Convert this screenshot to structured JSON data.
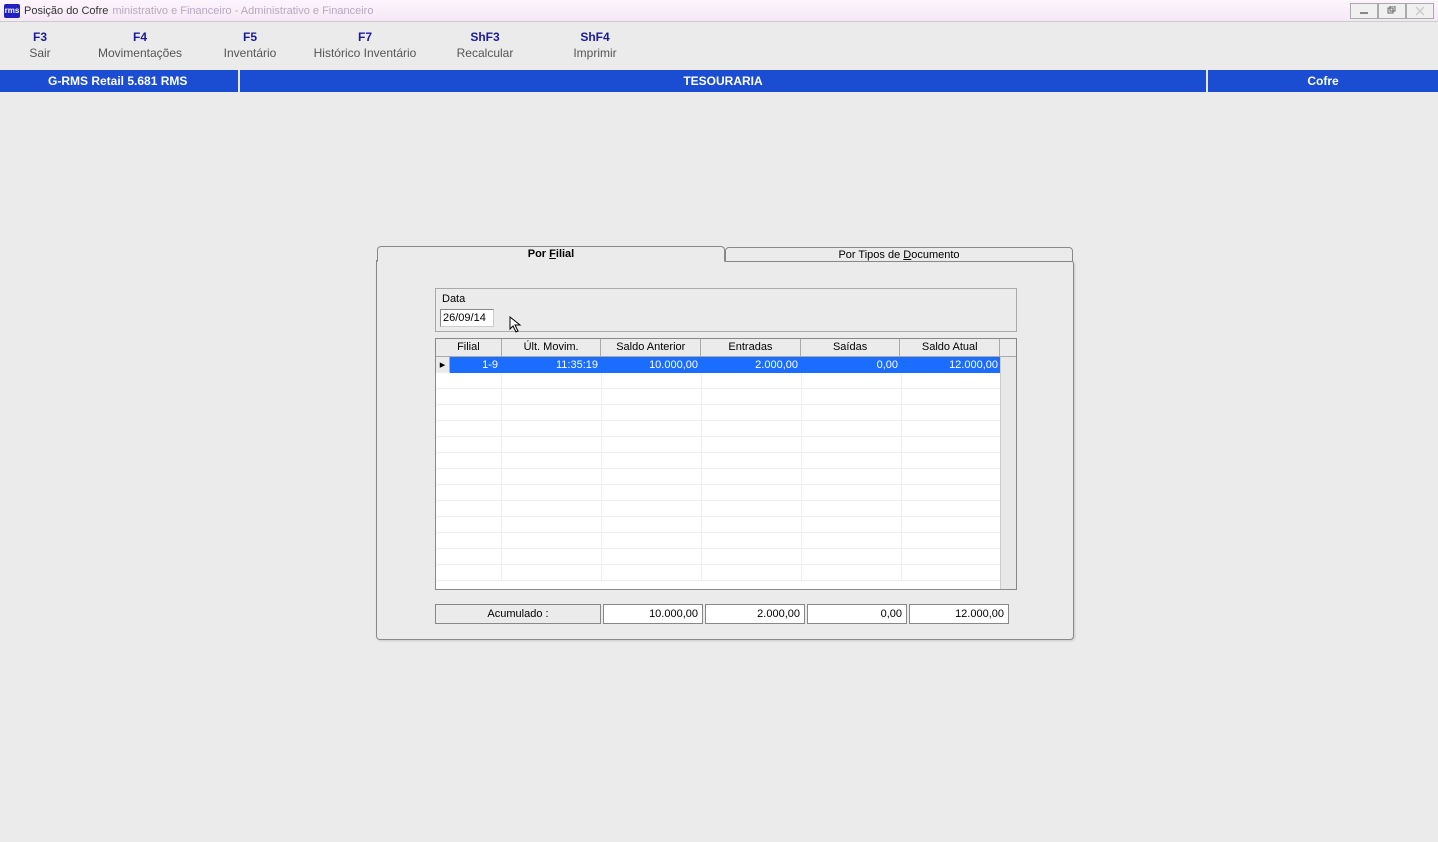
{
  "window": {
    "icon_text": "rms",
    "title": "Posição do Cofre",
    "title_suffix": "ministrativo e Financeiro - Administrativo e Financeiro"
  },
  "menu": [
    {
      "shortcut": "F3",
      "label": "Sair"
    },
    {
      "shortcut": "F4",
      "label": "Movimentações"
    },
    {
      "shortcut": "F5",
      "label": "Inventário"
    },
    {
      "shortcut": "F7",
      "label": "Histórico Inventário"
    },
    {
      "shortcut": "ShF3",
      "label": "Recalcular"
    },
    {
      "shortcut": "ShF4",
      "label": "Imprimir"
    }
  ],
  "info_bar": {
    "left": "G-RMS Retail 5.681 RMS",
    "center": "TESOURARIA",
    "right": "Cofre"
  },
  "tabs": {
    "active_prefix": "Por ",
    "active_underline": "F",
    "active_suffix": "ilial",
    "inactive_prefix": "Por Tipos de ",
    "inactive_underline": "D",
    "inactive_suffix": "ocumento"
  },
  "date": {
    "label": "Data",
    "value": "26/09/14"
  },
  "grid": {
    "headers": {
      "filial": "Filial",
      "ult_movim": "Últ. Movim.",
      "saldo_anterior": "Saldo Anterior",
      "entradas": "Entradas",
      "saidas": "Saídas",
      "saldo_atual": "Saldo Atual"
    },
    "rows": [
      {
        "filial": "1-9",
        "ult_movim": "11:35:19",
        "saldo_anterior": "10.000,00",
        "entradas": "2.000,00",
        "saidas": "0,00",
        "saldo_atual": "12.000,00"
      }
    ]
  },
  "totals": {
    "label": "Acumulado :",
    "saldo_anterior": "10.000,00",
    "entradas": "2.000,00",
    "saidas": "0,00",
    "saldo_atual": "12.000,00"
  }
}
